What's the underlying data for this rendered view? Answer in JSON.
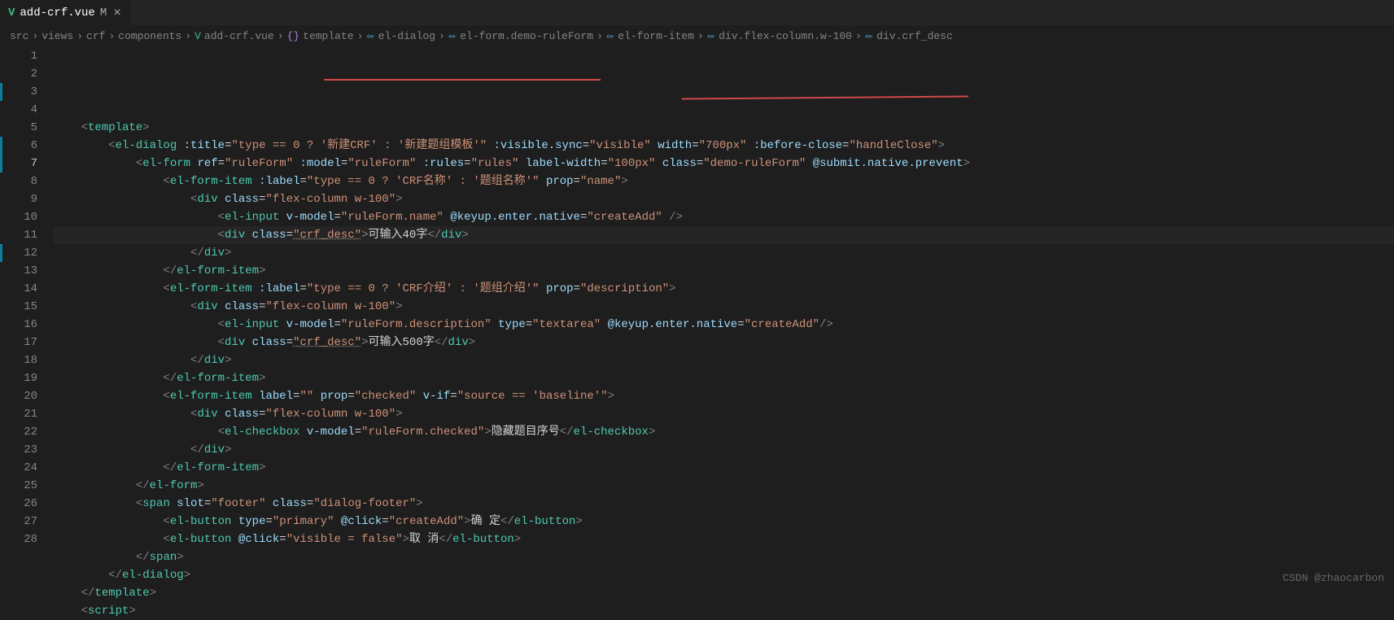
{
  "tab": {
    "icon": "V",
    "name": "add-crf.vue",
    "modified": "M",
    "close": "×"
  },
  "breadcrumb": {
    "items": [
      {
        "label": "src",
        "icon": ""
      },
      {
        "label": "views",
        "icon": ""
      },
      {
        "label": "crf",
        "icon": ""
      },
      {
        "label": "components",
        "icon": ""
      },
      {
        "label": "add-crf.vue",
        "icon": "vue"
      },
      {
        "label": "template",
        "icon": "brace"
      },
      {
        "label": "el-dialog",
        "icon": "tag"
      },
      {
        "label": "el-form.demo-ruleForm",
        "icon": "tag"
      },
      {
        "label": "el-form-item",
        "icon": "tag"
      },
      {
        "label": "div.flex-column.w-100",
        "icon": "tag"
      },
      {
        "label": "div.crf_desc",
        "icon": "tag"
      }
    ]
  },
  "lines": {
    "count": 28,
    "current": 7,
    "modified": [
      3,
      6,
      7,
      12
    ]
  },
  "code": {
    "l1": {
      "indent": "    ",
      "open": "<",
      "tag": "template",
      "close": ">"
    },
    "l2": {
      "indent": "        ",
      "open": "<",
      "tag": "el-dialog",
      "sp": " ",
      "a1": ":title",
      "eq1": "=",
      "v1": "\"type == 0 ? '新建CRF' : '新建题组模板'\"",
      "a2": ":visible.sync",
      "eq2": "=",
      "v2": "\"visible\"",
      "a3": "width",
      "eq3": "=",
      "v3": "\"700px\"",
      "a4": ":before-close",
      "eq4": "=",
      "v4": "\"handleClose\"",
      "close": ">"
    },
    "l3": {
      "indent": "            ",
      "open": "<",
      "tag": "el-form",
      "sp": " ",
      "a1": "ref",
      "eq1": "=",
      "v1": "\"ruleForm\"",
      "a2": ":model",
      "eq2": "=",
      "v2": "\"ruleForm\"",
      "a3": ":rules",
      "eq3": "=",
      "v3": "\"rules\"",
      "a4": "label-width",
      "eq4": "=",
      "v4": "\"100px\"",
      "a5": "class",
      "eq5": "=",
      "v5": "\"demo-ruleForm\"",
      "a6": "@submit.native.prevent",
      "close": ">"
    },
    "l4": {
      "indent": "                ",
      "open": "<",
      "tag": "el-form-item",
      "sp": " ",
      "a1": ":label",
      "eq1": "=",
      "v1": "\"type == 0 ? 'CRF名称' : '题组名称'\"",
      "a2": "prop",
      "eq2": "=",
      "v2": "\"name\"",
      "close": ">"
    },
    "l5": {
      "indent": "                    ",
      "open": "<",
      "tag": "div",
      "sp": " ",
      "a1": "class",
      "eq1": "=",
      "v1": "\"flex-column w-100\"",
      "close": ">"
    },
    "l6": {
      "indent": "                        ",
      "open": "<",
      "tag": "el-input",
      "sp": " ",
      "a1": "v-model",
      "eq1": "=",
      "v1": "\"ruleForm.name\"",
      "a2": "@keyup.enter.native",
      "eq2": "=",
      "v2": "\"createAdd\"",
      "close": " />"
    },
    "l7": {
      "indent": "                        ",
      "open": "<",
      "tag": "div",
      "sp": " ",
      "a1": "class",
      "eq1": "=",
      "v1": "\"crf_desc\"",
      "mid": ">",
      "text": "可输入40字",
      "copen": "</",
      "ctag": "div",
      "cclose": ">"
    },
    "l8": {
      "indent": "                    ",
      "open": "</",
      "tag": "div",
      "close": ">"
    },
    "l9": {
      "indent": "                ",
      "open": "</",
      "tag": "el-form-item",
      "close": ">"
    },
    "l10": {
      "indent": "                ",
      "open": "<",
      "tag": "el-form-item",
      "sp": " ",
      "a1": ":label",
      "eq1": "=",
      "v1": "\"type == 0 ? 'CRF介绍' : '题组介绍'\"",
      "a2": "prop",
      "eq2": "=",
      "v2": "\"description\"",
      "close": ">"
    },
    "l11": {
      "indent": "                    ",
      "open": "<",
      "tag": "div",
      "sp": " ",
      "a1": "class",
      "eq1": "=",
      "v1": "\"flex-column w-100\"",
      "close": ">"
    },
    "l12": {
      "indent": "                        ",
      "open": "<",
      "tag": "el-input",
      "sp": " ",
      "a1": "v-model",
      "eq1": "=",
      "v1": "\"ruleForm.description\"",
      "a2": "type",
      "eq2": "=",
      "v2": "\"textarea\"",
      "a3": "@keyup.enter.native",
      "eq3": "=",
      "v3": "\"createAdd\"",
      "close": "/>"
    },
    "l13": {
      "indent": "                        ",
      "open": "<",
      "tag": "div",
      "sp": " ",
      "a1": "class",
      "eq1": "=",
      "v1": "\"crf_desc\"",
      "mid": ">",
      "text": "可输入500字",
      "copen": "</",
      "ctag": "div",
      "cclose": ">"
    },
    "l14": {
      "indent": "                    ",
      "open": "</",
      "tag": "div",
      "close": ">"
    },
    "l15": {
      "indent": "                ",
      "open": "</",
      "tag": "el-form-item",
      "close": ">"
    },
    "l16": {
      "indent": "                ",
      "open": "<",
      "tag": "el-form-item",
      "sp": " ",
      "a1": "label",
      "eq1": "=",
      "v1": "\"\"",
      "a2": "prop",
      "eq2": "=",
      "v2": "\"checked\"",
      "a3": "v-if",
      "eq3": "=",
      "v3": "\"source == 'baseline'\"",
      "close": ">"
    },
    "l17": {
      "indent": "                    ",
      "open": "<",
      "tag": "div",
      "sp": " ",
      "a1": "class",
      "eq1": "=",
      "v1": "\"flex-column w-100\"",
      "close": ">"
    },
    "l18": {
      "indent": "                        ",
      "open": "<",
      "tag": "el-checkbox",
      "sp": " ",
      "a1": "v-model",
      "eq1": "=",
      "v1": "\"ruleForm.checked\"",
      "mid": ">",
      "text": "隐藏题目序号",
      "copen": "</",
      "ctag": "el-checkbox",
      "cclose": ">"
    },
    "l19": {
      "indent": "                    ",
      "open": "</",
      "tag": "div",
      "close": ">"
    },
    "l20": {
      "indent": "                ",
      "open": "</",
      "tag": "el-form-item",
      "close": ">"
    },
    "l21": {
      "indent": "            ",
      "open": "</",
      "tag": "el-form",
      "close": ">"
    },
    "l22": {
      "indent": "            ",
      "open": "<",
      "tag": "span",
      "sp": " ",
      "a1": "slot",
      "eq1": "=",
      "v1": "\"footer\"",
      "a2": "class",
      "eq2": "=",
      "v2": "\"dialog-footer\"",
      "close": ">"
    },
    "l23": {
      "indent": "                ",
      "open": "<",
      "tag": "el-button",
      "sp": " ",
      "a1": "type",
      "eq1": "=",
      "v1": "\"primary\"",
      "a2": "@click",
      "eq2": "=",
      "v2": "\"createAdd\"",
      "mid": ">",
      "text": "确 定",
      "copen": "</",
      "ctag": "el-button",
      "cclose": ">"
    },
    "l24": {
      "indent": "                ",
      "open": "<",
      "tag": "el-button",
      "sp": " ",
      "a1": "@click",
      "eq1": "=",
      "v1": "\"visible = false\"",
      "mid": ">",
      "text": "取 消",
      "copen": "</",
      "ctag": "el-button",
      "cclose": ">"
    },
    "l25": {
      "indent": "            ",
      "open": "</",
      "tag": "span",
      "close": ">"
    },
    "l26": {
      "indent": "        ",
      "open": "</",
      "tag": "el-dialog",
      "close": ">"
    },
    "l27": {
      "indent": "    ",
      "open": "</",
      "tag": "template",
      "close": ">"
    },
    "l28": {
      "indent": "    ",
      "open": "<",
      "tag": "script",
      "close": ">"
    }
  },
  "watermark": "CSDN @zhaocarbon"
}
